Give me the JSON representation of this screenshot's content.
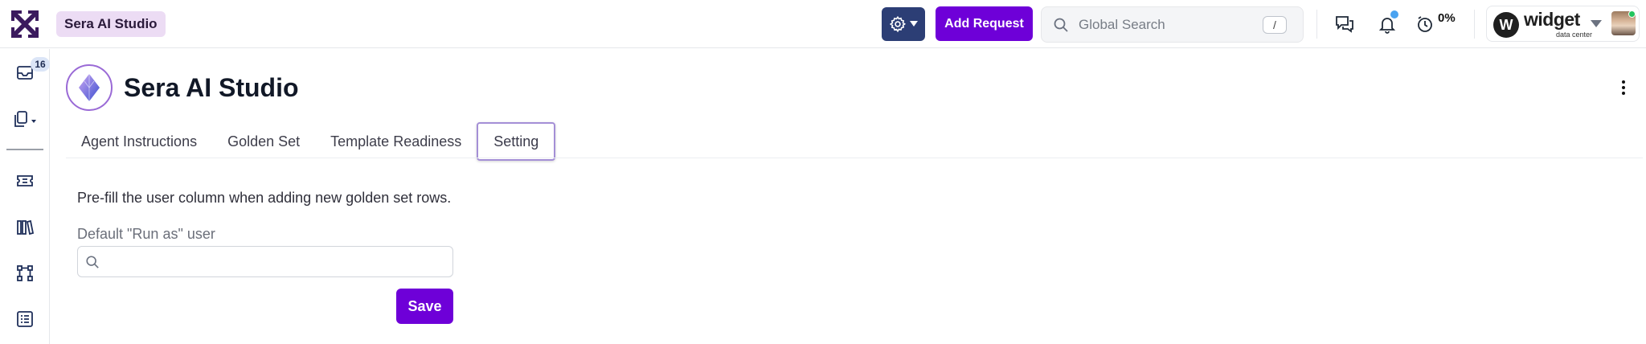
{
  "header": {
    "app_chip": "Sera AI Studio",
    "add_request_label": "Add Request",
    "search": {
      "placeholder": "Global Search",
      "shortcut": "/"
    },
    "timer_percent": "0%",
    "org": {
      "name": "widget",
      "subtitle": "data center",
      "logo_letter": "W"
    },
    "colors": {
      "primary": "#6e00d8",
      "gear_bg": "#2c3e75",
      "chip_bg": "#ecdcf4"
    }
  },
  "rail": {
    "inbox_badge": "16",
    "items": [
      "inbox-icon",
      "copy-dropdown-icon",
      "ticket-icon",
      "library-icon",
      "workflow-icon",
      "list-icon"
    ]
  },
  "page": {
    "title": "Sera AI Studio",
    "tabs": [
      {
        "label": "Agent Instructions",
        "active": false
      },
      {
        "label": "Golden Set",
        "active": false
      },
      {
        "label": "Template Readiness",
        "active": false
      },
      {
        "label": "Setting",
        "active": true
      }
    ],
    "setting": {
      "description": "Pre-fill the user column when adding new golden set rows.",
      "run_as_label": "Default \"Run as\" user",
      "run_as_value": "",
      "save_label": "Save"
    }
  }
}
